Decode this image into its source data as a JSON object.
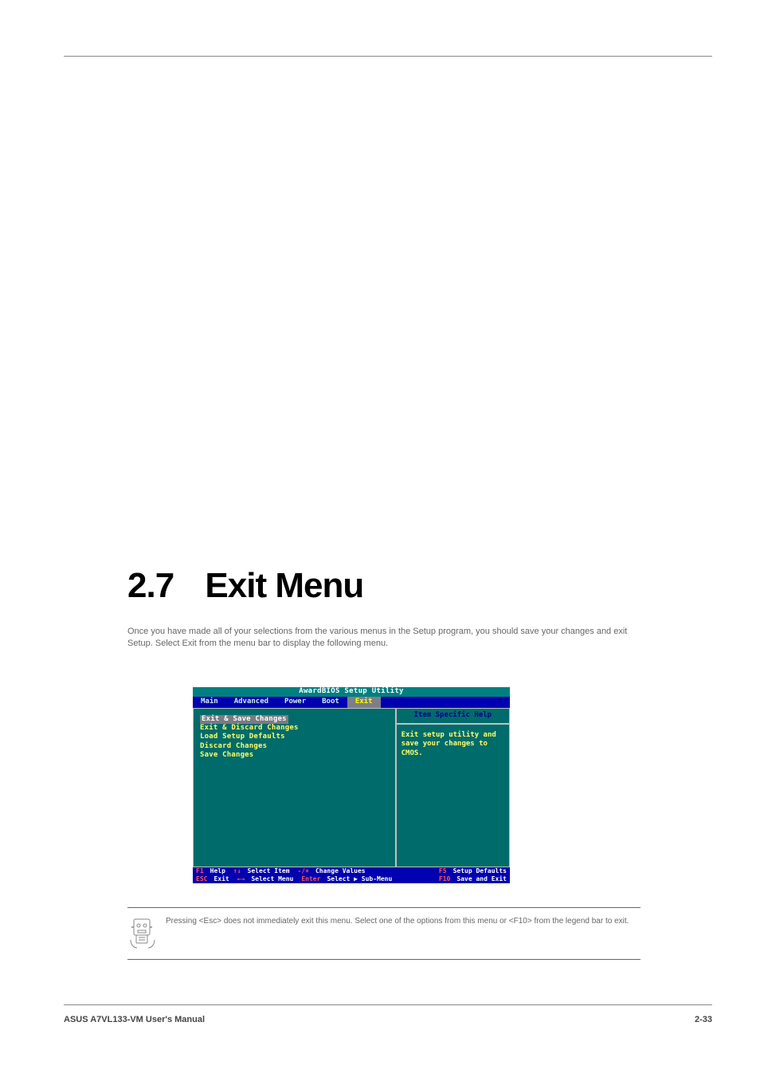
{
  "heading": {
    "number": "2.7",
    "title": "Exit Menu"
  },
  "intro": "Once you have made all of your selections from the various menus in the Setup program, you should save your changes and exit Setup. Select Exit from the menu bar to display the following menu.",
  "bios": {
    "title": "AwardBIOS Setup Utility",
    "tabs": [
      "Main",
      "Advanced",
      "Power",
      "Boot",
      "Exit"
    ],
    "active_tab_index": 4,
    "items": [
      "Exit & Save Changes",
      "Exit & Discard Changes",
      "Load Setup Defaults",
      "Discard Changes",
      "Save Changes"
    ],
    "selected_item_index": 0,
    "help": {
      "title": "Item Specific Help",
      "body": "Exit setup utility and save your changes to CMOS."
    },
    "footer": {
      "row1": [
        {
          "key": "F1",
          "label": "Help"
        },
        {
          "key": "↑↓",
          "label": "Select Item"
        },
        {
          "key": "-/+",
          "label": "Change Values"
        },
        {
          "key": "F5",
          "label": "Setup Defaults"
        }
      ],
      "row2": [
        {
          "key": "ESC",
          "label": "Exit"
        },
        {
          "key": "←→",
          "label": "Select Menu"
        },
        {
          "key": "Enter",
          "label": "Select ▶ Sub-Menu"
        },
        {
          "key": "F10",
          "label": "Save and Exit"
        }
      ]
    }
  },
  "note": "Pressing <Esc> does not immediately exit this menu. Select one of the options from this menu or <F10> from the legend bar to exit.",
  "footer": {
    "left": "ASUS A7VL133-VM User's Manual",
    "right": "2-33"
  }
}
